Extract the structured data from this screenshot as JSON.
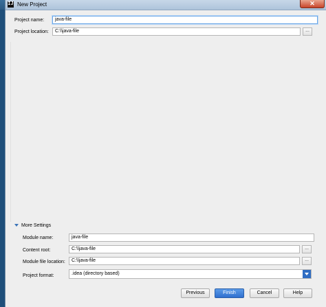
{
  "window": {
    "title": "New Project",
    "app_icon": "IJ",
    "close_label": "✕"
  },
  "project": {
    "name_label": "Project name:",
    "name_value": "java-file",
    "location_label": "Project location:",
    "location_value": "C:\\\\java-file",
    "browse_label": "..."
  },
  "more_settings": {
    "toggle_label": "More Settings",
    "module_name_label": "Module name:",
    "module_name_value": "java-file",
    "content_root_label": "Content root:",
    "content_root_value": "C:\\\\java-file",
    "module_file_label": "Module file location:",
    "module_file_value": "C:\\\\java-file",
    "format_label": "Project format:",
    "format_value": ".idea (directory based)",
    "browse_label": "..."
  },
  "buttons": {
    "previous": "Previous",
    "finish": "Finish",
    "cancel": "Cancel",
    "help": "Help"
  }
}
